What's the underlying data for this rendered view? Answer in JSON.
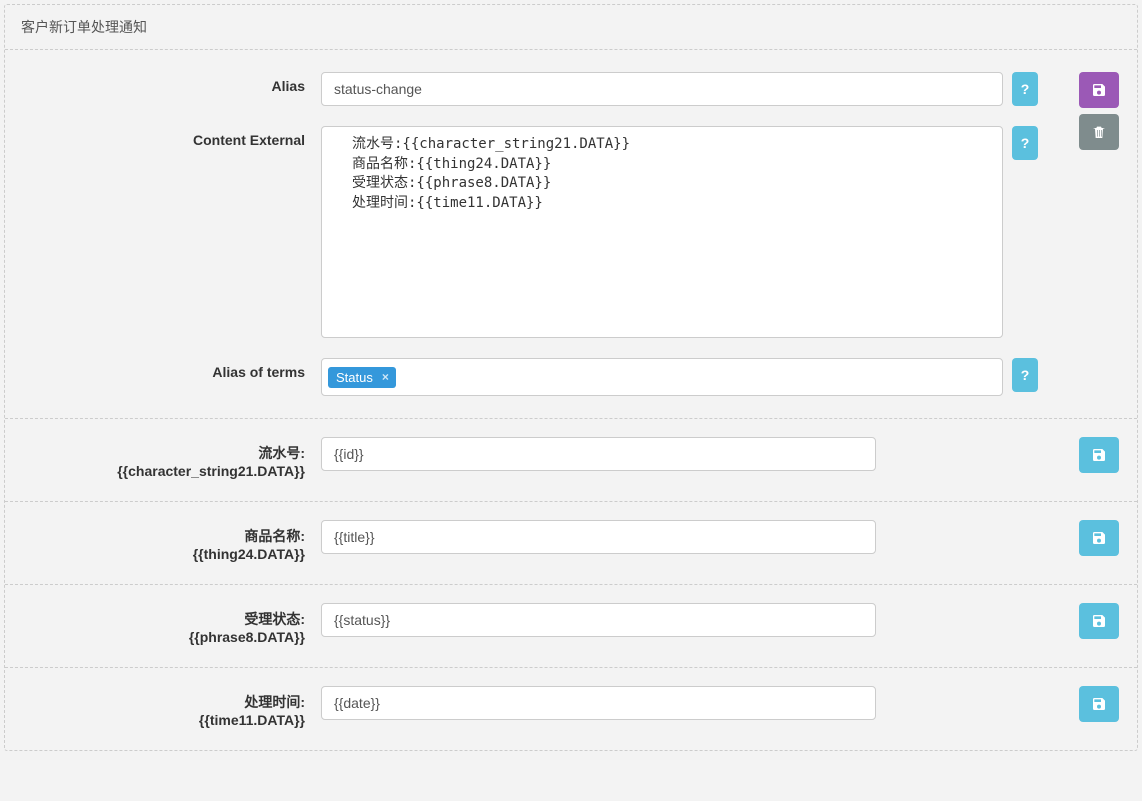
{
  "panel": {
    "title": "客户新订单处理通知"
  },
  "form": {
    "alias": {
      "label": "Alias",
      "value": "status-change",
      "help": "?"
    },
    "contentExternal": {
      "label": "Content External",
      "help": "?",
      "text": "流水号:{{character_string21.DATA}}\n商品名称:{{thing24.DATA}}\n受理状态:{{phrase8.DATA}}\n处理时间:{{time11.DATA}}"
    },
    "aliasOfTerms": {
      "label": "Alias of terms",
      "help": "?",
      "tags": [
        {
          "label": "Status"
        }
      ]
    }
  },
  "rows": [
    {
      "label_line1": "流水号:",
      "label_line2": "{{character_string21.DATA}}",
      "value": "{{id}}"
    },
    {
      "label_line1": "商品名称:",
      "label_line2": "{{thing24.DATA}}",
      "value": "{{title}}"
    },
    {
      "label_line1": "受理状态:",
      "label_line2": "{{phrase8.DATA}}",
      "value": "{{status}}"
    },
    {
      "label_line1": "处理时间:",
      "label_line2": "{{time11.DATA}}",
      "value": "{{date}}"
    }
  ],
  "icons": {
    "save": "save",
    "delete": "trash"
  }
}
